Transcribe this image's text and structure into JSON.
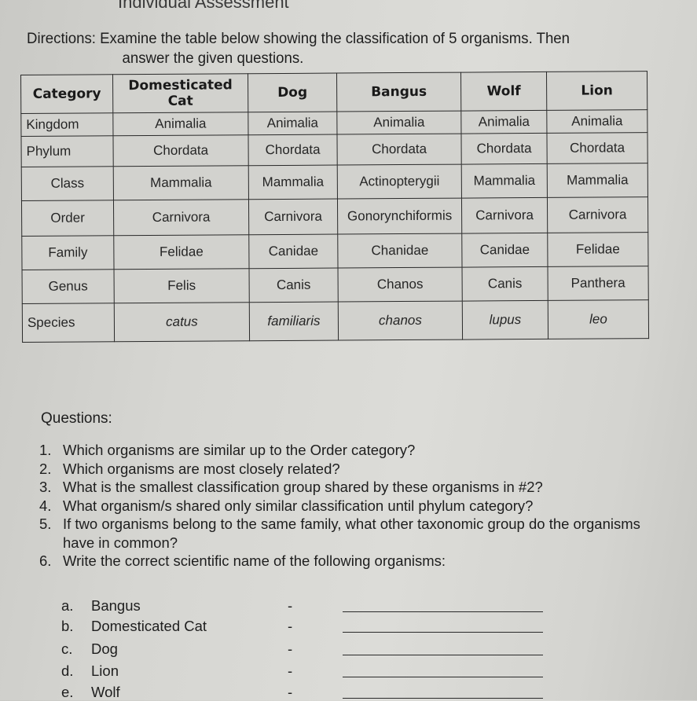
{
  "page": {
    "header_fragment": "Individual Assessment",
    "directions_line1": "Directions: Examine the table below showing the classification of 5  organisms. Then",
    "directions_line2": "answer the given questions."
  },
  "table": {
    "headers": [
      "Category",
      "Domesticated Cat",
      "Dog",
      "Bangus",
      "Wolf",
      "Lion"
    ],
    "rows": [
      {
        "category": "Kingdom",
        "values": [
          "Animalia",
          "Animalia",
          "Animalia",
          "Animalia",
          "Animalia"
        ]
      },
      {
        "category": "Phylum",
        "values": [
          "Chordata",
          "Chordata",
          "Chordata",
          "Chordata",
          "Chordata"
        ]
      },
      {
        "category": "Class",
        "values": [
          "Mammalia",
          "Mammalia",
          "Actinopterygii",
          "Mammalia",
          "Mammalia"
        ]
      },
      {
        "category": "Order",
        "values": [
          "Carnivora",
          "Carnivora",
          "Gonorynchiformis",
          "Carnivora",
          "Carnivora"
        ]
      },
      {
        "category": "Family",
        "values": [
          "Felidae",
          "Canidae",
          "Chanidae",
          "Canidae",
          "Felidae"
        ]
      },
      {
        "category": "Genus",
        "values": [
          "Felis",
          "Canis",
          "Chanos",
          "Canis",
          "Panthera"
        ]
      },
      {
        "category": "Species",
        "values": [
          "catus",
          "familiaris",
          "chanos",
          "lupus",
          "leo"
        ]
      }
    ]
  },
  "questions": {
    "title": "Questions:",
    "items": [
      {
        "num": "1.",
        "text": "Which organisms are similar up to the Order category?"
      },
      {
        "num": "2.",
        "text": "Which organisms are most closely related?"
      },
      {
        "num": "3.",
        "text": "What is the smallest classification group shared by these organisms in #2?"
      },
      {
        "num": "4.",
        "text": "What organism/s shared only similar classification until phylum category?"
      },
      {
        "num": "5.",
        "text": "If two organisms belong to the same family, what other taxonomic group do the organisms have in common?"
      },
      {
        "num": "6.",
        "text": "Write the correct scientific name of the following organisms:"
      }
    ],
    "sub_items": [
      {
        "letter": "a.",
        "name": "Bangus",
        "dash": "-"
      },
      {
        "letter": "b.",
        "name": "Domesticated Cat",
        "dash": "-"
      },
      {
        "letter": "c.",
        "name": "Dog",
        "dash": "-"
      },
      {
        "letter": "d.",
        "name": "Lion",
        "dash": "-"
      },
      {
        "letter": "e.",
        "name": "Wolf",
        "dash": "-"
      }
    ]
  }
}
